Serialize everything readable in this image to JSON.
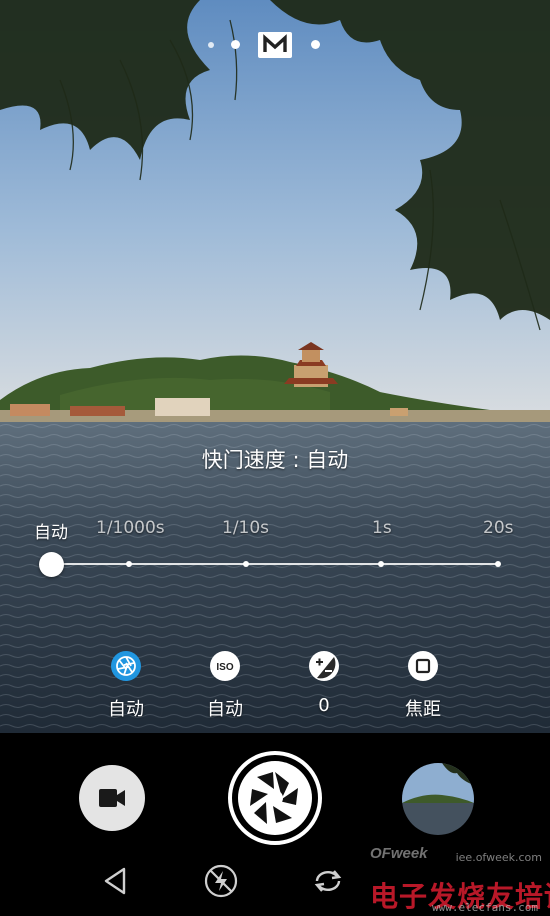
{
  "mode_indicator": {
    "active_mode": "M",
    "icon": "manual-mode-icon"
  },
  "shutter_panel": {
    "title": "快门速度 : 自动",
    "ticks": [
      "自动",
      "1/1000s",
      "1/10s",
      "1s",
      "20s"
    ],
    "selected": "自动",
    "selected_index": 0
  },
  "parameters": [
    {
      "icon": "shutter-aperture-icon",
      "label": "自动",
      "active": true,
      "accent": "#2196e0"
    },
    {
      "icon": "iso-icon",
      "icon_text": "ISO",
      "label": "自动",
      "active": false
    },
    {
      "icon": "exposure-compensation-icon",
      "label": "0",
      "active": false
    },
    {
      "icon": "focus-icon",
      "label": "焦距",
      "active": false
    }
  ],
  "controls": {
    "video_icon": "video-camera-icon",
    "shutter_icon": "shutter-icon",
    "gallery_icon": "gallery-thumbnail"
  },
  "nav": {
    "back_icon": "back-triangle-icon",
    "flash_icon": "flash-off-icon",
    "switch_icon": "switch-camera-icon"
  },
  "watermark": {
    "brand": "OFweek",
    "site": "iee.ofweek.com",
    "line": "电子发烧友培训",
    "url": "www.elecfans.com"
  }
}
